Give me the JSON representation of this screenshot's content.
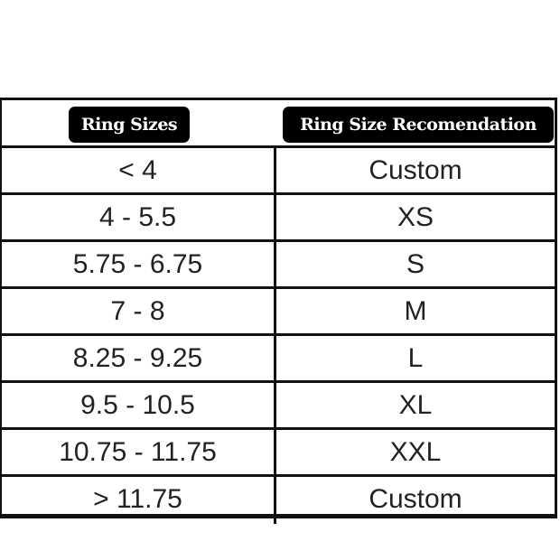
{
  "headers": {
    "ring_sizes": "Ring Sizes",
    "recommendation": "Ring Size Recomendation"
  },
  "rows": [
    {
      "size": "< 4",
      "rec": "Custom"
    },
    {
      "size": "4 - 5.5",
      "rec": "XS"
    },
    {
      "size": "5.75 - 6.75",
      "rec": "S"
    },
    {
      "size": "7 - 8",
      "rec": "M"
    },
    {
      "size": "8.25 - 9.25",
      "rec": "L"
    },
    {
      "size": "9.5 - 10.5",
      "rec": "XL"
    },
    {
      "size": "10.75 - 11.75",
      "rec": "XXL"
    },
    {
      "size": "> 11.75",
      "rec": "Custom"
    }
  ]
}
